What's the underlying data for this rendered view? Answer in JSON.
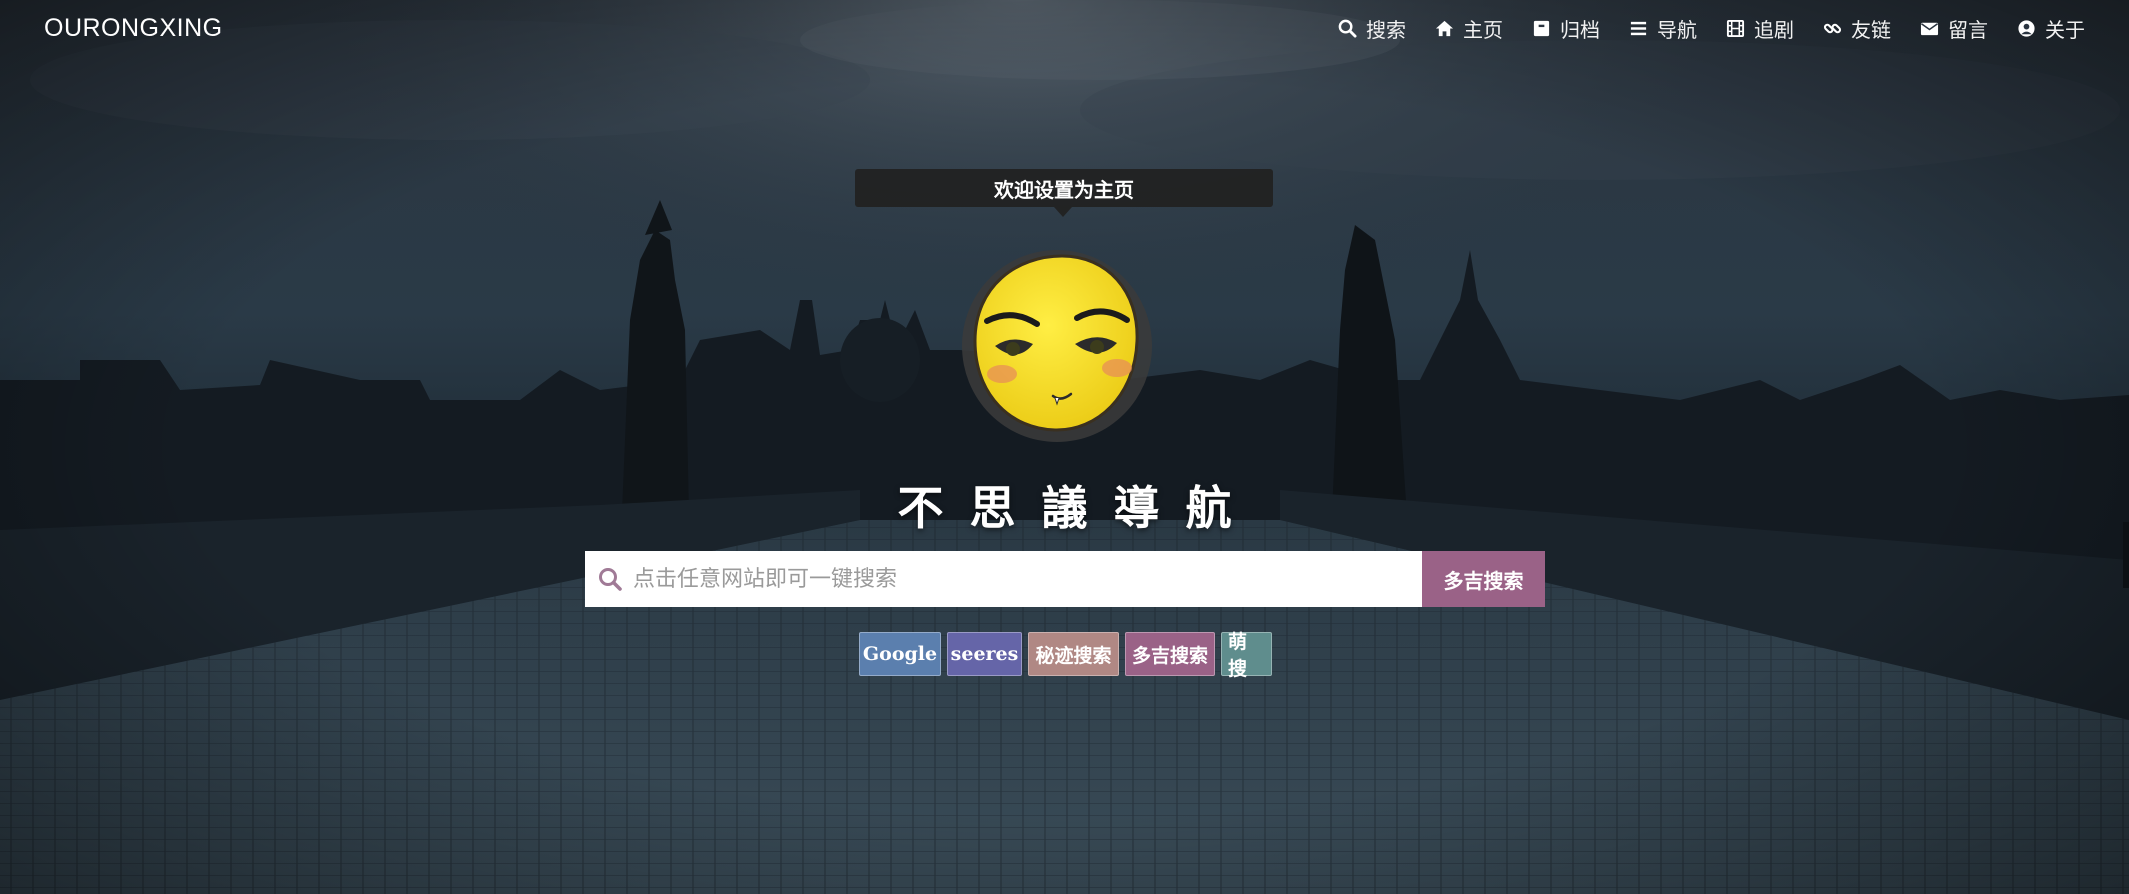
{
  "header": {
    "brand": "OURONGXING",
    "nav": [
      {
        "icon": "search-icon",
        "label": "搜索"
      },
      {
        "icon": "home-icon",
        "label": "主页"
      },
      {
        "icon": "archive-icon",
        "label": "归档"
      },
      {
        "icon": "list-icon",
        "label": "导航"
      },
      {
        "icon": "film-icon",
        "label": "追剧"
      },
      {
        "icon": "link-icon",
        "label": "友链"
      },
      {
        "icon": "envelope-icon",
        "label": "留言"
      },
      {
        "icon": "user-circle-icon",
        "label": "关于"
      }
    ]
  },
  "hero": {
    "tooltip": "欢迎设置为主页",
    "title": "不思議導航",
    "search": {
      "placeholder": "点击任意网站即可一键搜索",
      "button": "多吉搜索"
    },
    "engines": [
      {
        "label": "Google",
        "color": "#5b7fae"
      },
      {
        "label": "seeres",
        "color": "#6565a8"
      },
      {
        "label": "秘迹搜索",
        "color": "#b08884"
      },
      {
        "label": "多吉搜索",
        "color": "#9a6287"
      },
      {
        "label": "萌搜",
        "color": "#5f8d8d"
      }
    ]
  },
  "colors": {
    "search_button": "#9a6287",
    "search_icon": "#a07a96"
  }
}
